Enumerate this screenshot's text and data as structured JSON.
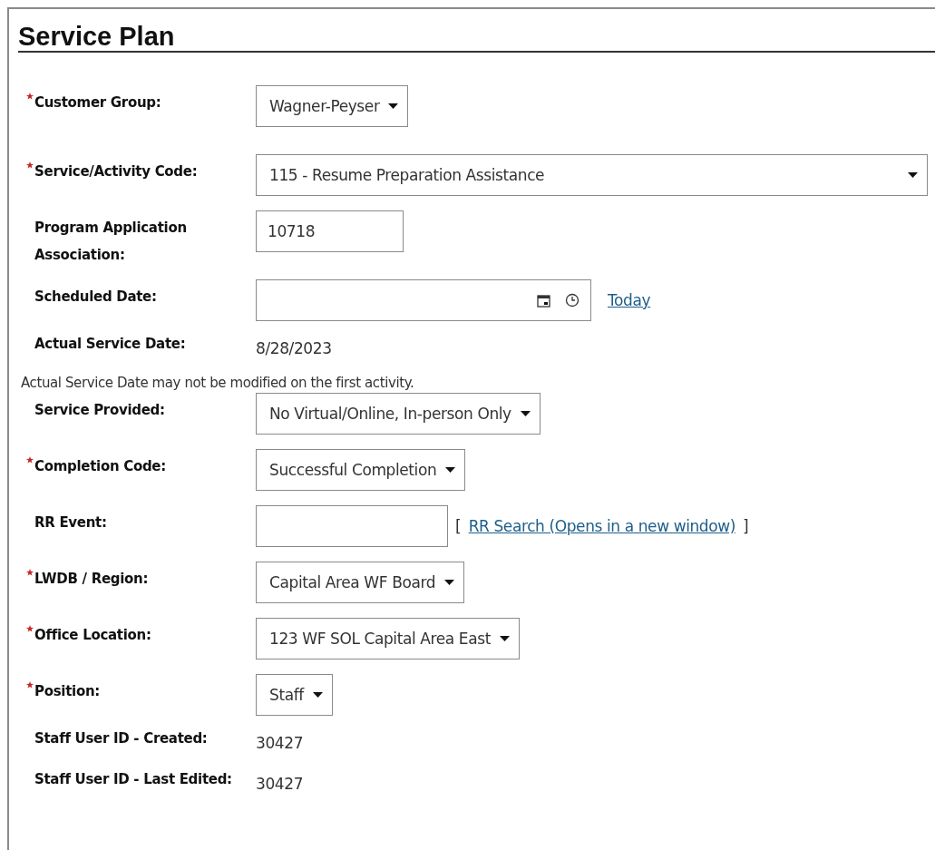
{
  "title": "Service Plan",
  "fields": [
    {
      "kind": "select",
      "label": "Customer Group:",
      "required": true,
      "value": "Wagner-Peyser"
    },
    {
      "kind": "wide_select",
      "label": "Service/Activity Code:",
      "required": true,
      "value": "115 - Resume Preparation Assistance"
    },
    {
      "kind": "input",
      "label": "Program Application Association:",
      "required": false,
      "value": "10718"
    },
    {
      "kind": "datetime",
      "label": "Scheduled Date:",
      "required": false,
      "link": "Today"
    },
    {
      "kind": "static",
      "label": "Actual Service Date:",
      "required": false,
      "value": "8/28/2023"
    },
    {
      "kind": "note",
      "text": "Actual Service Date may not be modified on the first activity."
    },
    {
      "kind": "select",
      "label": "Service Provided:",
      "required": false,
      "value": "No Virtual/Online, In-person Only"
    },
    {
      "kind": "select",
      "label": "Completion Code:",
      "required": true,
      "value": "Successful Completion"
    },
    {
      "kind": "lookup",
      "label": "RR Event:",
      "required": false,
      "bracket_open": "[",
      "link": "RR Search (Opens in a new window)",
      "bracket_close": "]"
    },
    {
      "kind": "select",
      "label": "LWDB / Region:",
      "required": true,
      "value": "Capital Area WF Board"
    },
    {
      "kind": "select",
      "label": "Office Location:",
      "required": true,
      "value": "123 WF SOL Capital Area East"
    },
    {
      "kind": "select",
      "label": "Position:",
      "required": true,
      "value": "Staff"
    },
    {
      "kind": "static",
      "label": "Staff User ID - Created:",
      "required": false,
      "value": "30427"
    },
    {
      "kind": "static",
      "label": "Staff User ID - Last Edited:",
      "required": false,
      "value": "30427"
    }
  ]
}
